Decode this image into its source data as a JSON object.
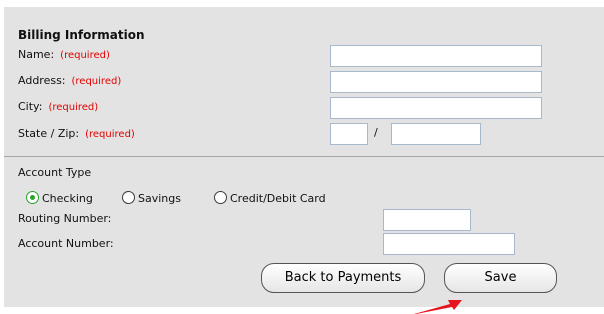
{
  "billing": {
    "title": "Billing Information",
    "required_text": "(required)",
    "name_label": "Name:",
    "address_label": "Address:",
    "city_label": "City:",
    "statezip_label": "State / Zip:",
    "zip_separator": "/",
    "name_value": "",
    "address_value": "",
    "city_value": "",
    "state_value": "",
    "zip_value": ""
  },
  "account": {
    "type_label": "Account Type",
    "options": [
      {
        "label": "Checking",
        "selected": true
      },
      {
        "label": "Savings",
        "selected": false
      },
      {
        "label": "Credit/Debit Card",
        "selected": false
      }
    ],
    "routing_label": "Routing Number:",
    "account_label": "Account Number:",
    "routing_value": "",
    "account_value": ""
  },
  "buttons": {
    "back_label": "Back to Payments",
    "save_label": "Save"
  },
  "colors": {
    "panel_bg": "#e3e3e3",
    "required_red": "#e20000",
    "radio_green": "#2ca12c",
    "arrow_red": "#e8141c"
  },
  "annotation": {
    "arrow_icon": "red-arrow-icon"
  }
}
